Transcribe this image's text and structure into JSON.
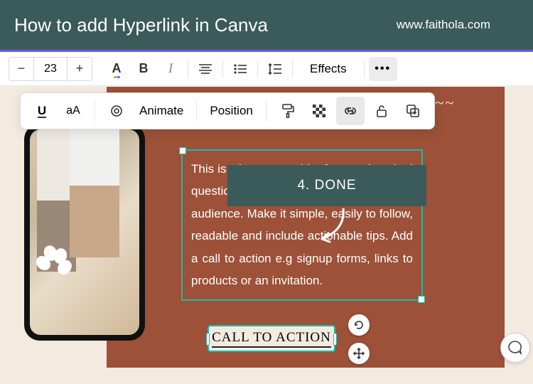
{
  "header": {
    "title": "How to add Hyperlink in Canva",
    "url": "www.faithola.com"
  },
  "toolbar1": {
    "font_size": "23",
    "effects_label": "Effects"
  },
  "toolbar2": {
    "animate_label": "Animate",
    "position_label": "Position",
    "case_label": "aA"
  },
  "canvas": {
    "scribble": "~~~~~~~",
    "faq_text": "This is where you add a frequently asked question and explain it indepthly to your audience. Make it simple, easily to follow, readable and include actionable tips. Add a call to action e.g signup forms, links to products or an invitation.",
    "cta_label": "CALL TO ACTION"
  },
  "annotation": {
    "step_label": "4. DONE"
  }
}
